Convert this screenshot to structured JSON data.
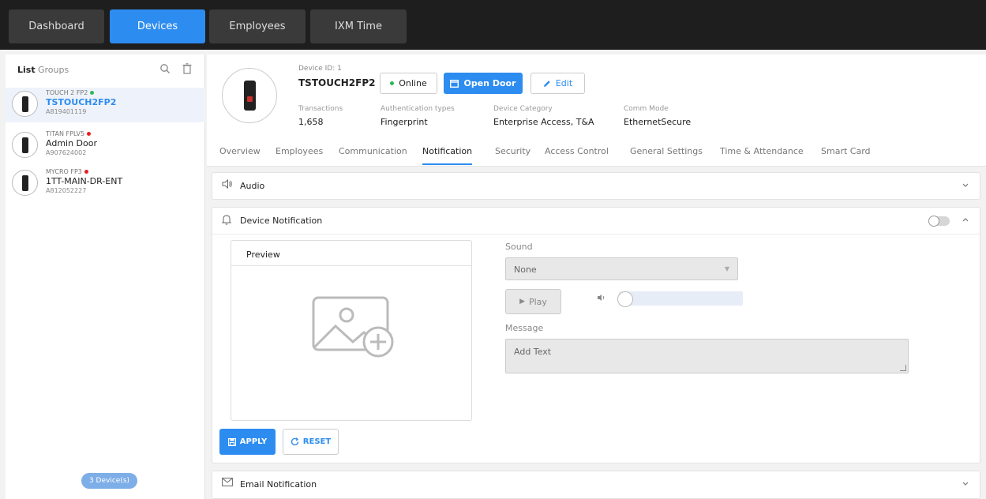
{
  "nav": {
    "dashboard": "Dashboard",
    "devices": "Devices",
    "employees": "Employees",
    "ixm_time": "IXM Time"
  },
  "left_panel": {
    "tab_list": "List",
    "tab_groups": "Groups",
    "search_icon": "search-icon",
    "trash_icon": "trash-icon",
    "devices": [
      {
        "model": "TOUCH 2 FP2",
        "name": "TSTOUCH2FP2",
        "serial": "A819401119",
        "status": "online"
      },
      {
        "model": "TITAN FPLV5",
        "name": "Admin Door",
        "serial": "A907624002",
        "status": "offline"
      },
      {
        "model": "MYCRO FP3",
        "name": "1TT-MAIN-DR-ENT",
        "serial": "A812052227",
        "status": "offline"
      }
    ],
    "count": "3 Device(s)"
  },
  "device": {
    "id_label": "Device ID: 1",
    "name": "TSTOUCH2FP2",
    "status_label": "Online",
    "open_door_label": "Open Door",
    "edit_label": "Edit",
    "transactions_label": "Transactions",
    "transactions_value": "1,658",
    "auth_label": "Authentication types",
    "auth_value": "Fingerprint",
    "category_label": "Device Category",
    "category_value": "Enterprise Access, T&A",
    "comm_label": "Comm Mode",
    "comm_value": "EthernetSecure"
  },
  "tabs": {
    "overview": "Overview",
    "employees": "Employees",
    "communication": "Communication",
    "notification": "Notification",
    "security": "Security",
    "access_control": "Access Control",
    "general_settings": "General Settings",
    "time_attendance": "Time & Attendance",
    "smart_card": "Smart Card"
  },
  "audio_panel": {
    "title": "Audio"
  },
  "notification_panel": {
    "title": "Device Notification",
    "preview_title": "Preview",
    "sound_label": "Sound",
    "sound_value": "None",
    "play_label": "Play",
    "message_label": "Message",
    "message_placeholder": "Add Text",
    "apply_label": "APPLY",
    "reset_label": "RESET"
  },
  "email_panel": {
    "title": "Email Notification"
  },
  "colors": {
    "accent": "#2d8cf0",
    "online": "#2eb85c",
    "offline": "#e81f1f"
  }
}
